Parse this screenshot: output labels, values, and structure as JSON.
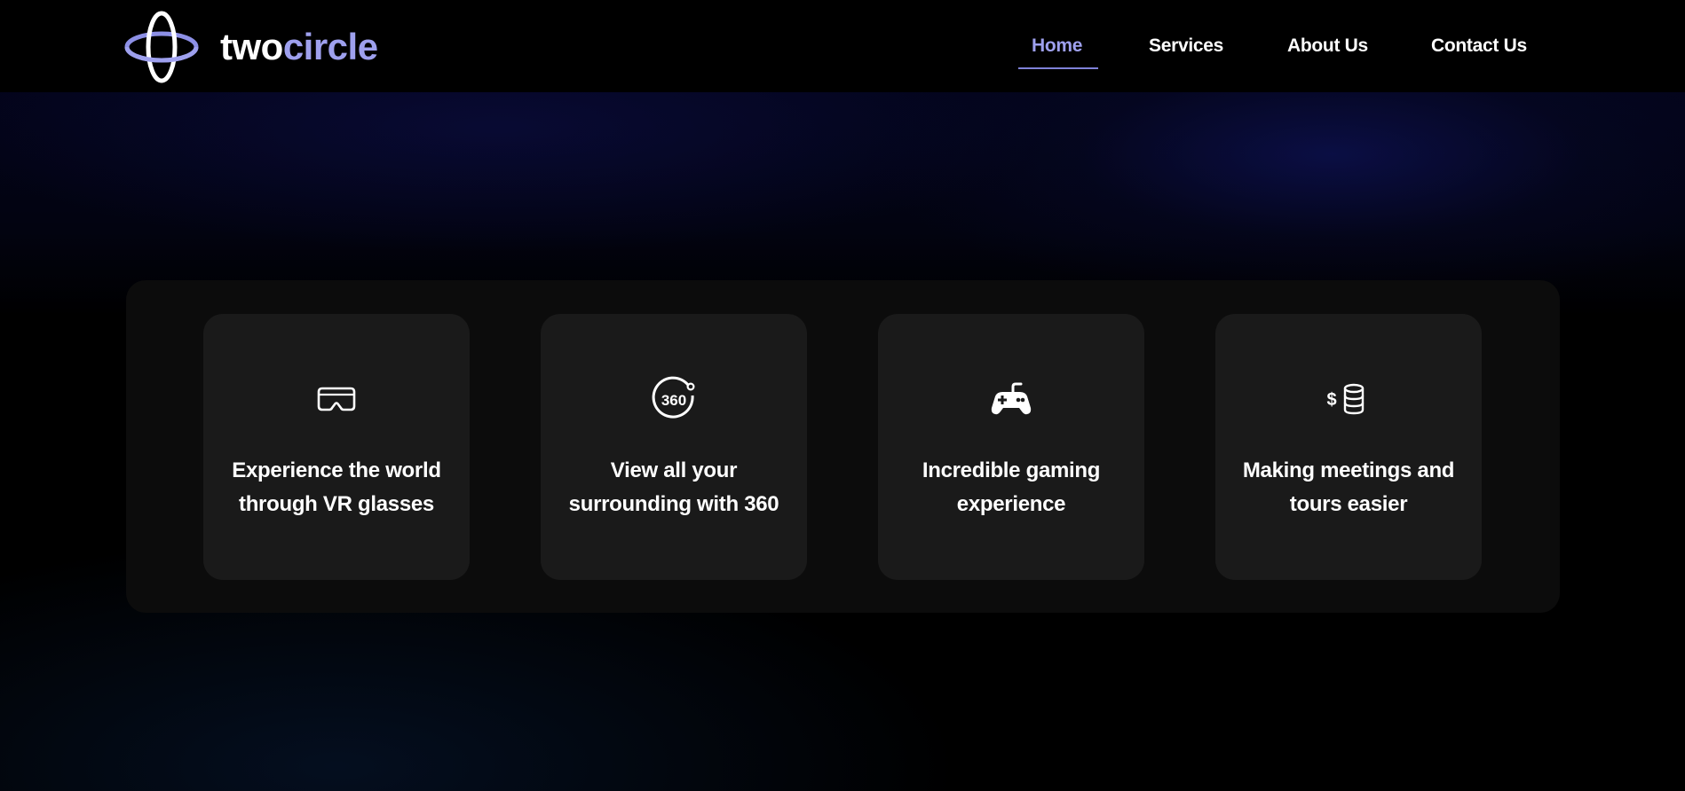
{
  "brand": {
    "part1": "two",
    "part2": "circle",
    "accent_color": "#9ea0ee"
  },
  "nav": {
    "items": [
      {
        "label": "Home",
        "active": true
      },
      {
        "label": "Services",
        "active": false
      },
      {
        "label": "About Us",
        "active": false
      },
      {
        "label": "Contact Us",
        "active": false
      }
    ]
  },
  "features": [
    {
      "icon": "vr-headset-icon",
      "text_line1": "Experience the world",
      "text_line2": "through VR glasses"
    },
    {
      "icon": "360-view-icon",
      "text_line1": "View all your",
      "text_line2": "surrounding with 360"
    },
    {
      "icon": "gamepad-icon",
      "text_line1": "Incredible gaming",
      "text_line2": "experience"
    },
    {
      "icon": "dollar-coins-icon",
      "text_line1": "Making meetings and",
      "text_line2": "tours easier"
    }
  ],
  "colors": {
    "background": "#000000",
    "panel": "#0c0c0c",
    "card": "#1a1a1a",
    "accent": "#9ea0ee"
  }
}
